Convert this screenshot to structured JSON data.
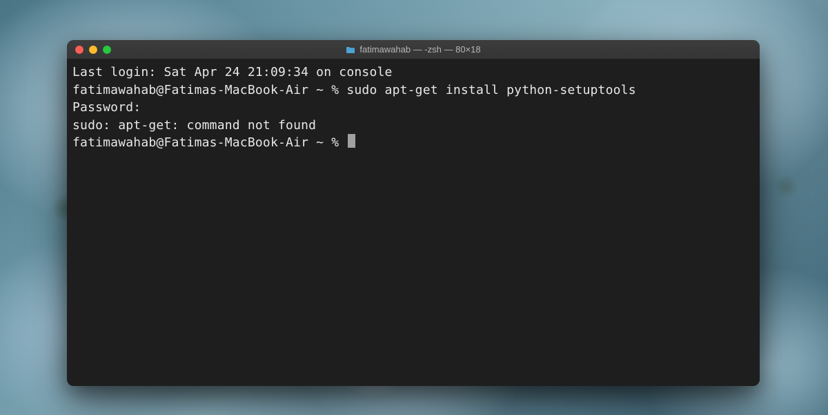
{
  "window": {
    "title": "fatimawahab — -zsh — 80×18"
  },
  "terminal": {
    "lines": {
      "l0": "Last login: Sat Apr 24 21:09:34 on console",
      "l1_prompt": "fatimawahab@Fatimas-MacBook-Air ~ % ",
      "l1_cmd": "sudo apt-get install python-setuptools",
      "l2": "Password:",
      "l3": "sudo: apt-get: command not found",
      "l4_prompt": "fatimawahab@Fatimas-MacBook-Air ~ % "
    }
  }
}
